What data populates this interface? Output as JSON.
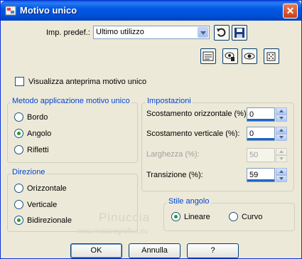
{
  "window": {
    "title": "Motivo unico"
  },
  "preset": {
    "label": "Imp. predef.:",
    "value": "Ultimo utilizzo"
  },
  "preview_checkbox": {
    "label": "Visualizza anteprima motivo unico",
    "checked": false
  },
  "method_group": {
    "title": "Metodo applicazione motivo unico",
    "options": [
      {
        "label": "Bordo",
        "selected": false
      },
      {
        "label": "Angolo",
        "selected": true
      },
      {
        "label": "Rifletti",
        "selected": false
      }
    ]
  },
  "direction_group": {
    "title": "Direzione",
    "options": [
      {
        "label": "Orizzontale",
        "selected": false
      },
      {
        "label": "Verticale",
        "selected": false
      },
      {
        "label": "Bidirezionale",
        "selected": true
      }
    ]
  },
  "settings_group": {
    "title": "Impostazioni",
    "fields": [
      {
        "label": "Scostamento orizzontale (%):",
        "value": "0",
        "enabled": true
      },
      {
        "label": "Scostamento verticale (%):",
        "value": "0",
        "enabled": true
      },
      {
        "label": "Larghezza (%):",
        "value": "50",
        "enabled": false
      },
      {
        "label": "Transizione (%):",
        "value": "59",
        "enabled": true
      }
    ]
  },
  "corner_style_group": {
    "title": "Stile angolo",
    "options": [
      {
        "label": "Lineare",
        "selected": true
      },
      {
        "label": "Curvo",
        "selected": false
      }
    ]
  },
  "buttons": {
    "ok": "OK",
    "cancel": "Annulla",
    "help": "?"
  },
  "watermark": {
    "line1": "Pinuccia",
    "line2": "www.maidiregrafica.eu"
  },
  "icons": [
    "app-icon",
    "close-icon",
    "reset-icon",
    "save-preset-icon",
    "toggle-view-icon",
    "proof-icon",
    "preview-icon",
    "randomize-icon"
  ]
}
